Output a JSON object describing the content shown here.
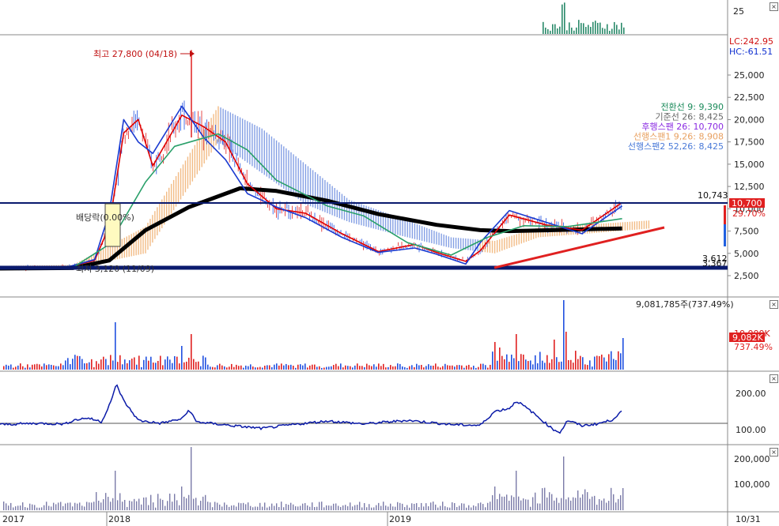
{
  "chart_data": [
    {
      "type": "line",
      "panel": "price",
      "title": "",
      "x_ticks": [
        "2017",
        "2018",
        "2019",
        "10/31"
      ],
      "y_ticks": [
        "25,000",
        "22,500",
        "20,000",
        "17,500",
        "15,000",
        "12,500",
        "10,000",
        "7,500",
        "5,000",
        "2,500"
      ],
      "ylim": [
        1000,
        28500
      ],
      "annotations": {
        "high": "최고 27,800 (04/18)",
        "low": "최저 3,120 (11/09)",
        "dividend": "배당락(0.00%)",
        "level_high": "10,743",
        "level_low_a": "3,612",
        "level_low_b": "3,367",
        "price_box": "10,700",
        "change_pct": "29.70%",
        "lc": "LC:242.95",
        "hc": "HC:-61.51"
      },
      "legend": [
        {
          "label": "전환선 9: 9,390",
          "color": "#1a8a5a"
        },
        {
          "label": "기준선 26: 8,425",
          "color": "#666666"
        },
        {
          "label": "후행스팬 26: 10,700",
          "color": "#8a2be2"
        },
        {
          "label": "선행스팬1 9,26: 8,908",
          "color": "#e8a060"
        },
        {
          "label": "선행스팬2 52,26: 8,425",
          "color": "#4a7ad8"
        }
      ],
      "series": [
        {
          "color": "#000000",
          "values": [
            [
              0,
              3300
            ],
            [
              0.1,
              3350
            ],
            [
              0.15,
              4200
            ],
            [
              0.2,
              7600
            ],
            [
              0.26,
              10200
            ],
            [
              0.33,
              12300
            ],
            [
              0.38,
              12000
            ],
            [
              0.45,
              10900
            ],
            [
              0.52,
              9400
            ],
            [
              0.6,
              8200
            ],
            [
              0.66,
              7600
            ],
            [
              0.7,
              7500
            ],
            [
              0.76,
              7600
            ],
            [
              0.855,
              7800
            ]
          ]
        },
        {
          "color": "#e00000",
          "values": [
            [
              0,
              3300
            ],
            [
              0.09,
              3400
            ],
            [
              0.13,
              4200
            ],
            [
              0.15,
              8000
            ],
            [
              0.17,
              18500
            ],
            [
              0.19,
              20000
            ],
            [
              0.21,
              14800
            ],
            [
              0.25,
              20500
            ],
            [
              0.28,
              19200
            ],
            [
              0.31,
              17500
            ],
            [
              0.34,
              12800
            ],
            [
              0.38,
              10000
            ],
            [
              0.42,
              9500
            ],
            [
              0.47,
              7200
            ],
            [
              0.52,
              5200
            ],
            [
              0.57,
              6000
            ],
            [
              0.6,
              5100
            ],
            [
              0.64,
              4100
            ],
            [
              0.66,
              5300
            ],
            [
              0.7,
              9300
            ],
            [
              0.75,
              8200
            ],
            [
              0.8,
              7600
            ],
            [
              0.855,
              10700
            ]
          ]
        },
        {
          "color": "#1a3ad0",
          "values": [
            [
              0,
              3300
            ],
            [
              0.09,
              3400
            ],
            [
              0.13,
              4300
            ],
            [
              0.15,
              9500
            ],
            [
              0.17,
              20000
            ],
            [
              0.19,
              17500
            ],
            [
              0.21,
              16200
            ],
            [
              0.25,
              21500
            ],
            [
              0.28,
              18000
            ],
            [
              0.31,
              15500
            ],
            [
              0.34,
              11700
            ],
            [
              0.38,
              10200
            ],
            [
              0.42,
              9000
            ],
            [
              0.47,
              6800
            ],
            [
              0.52,
              5100
            ],
            [
              0.57,
              5600
            ],
            [
              0.6,
              4900
            ],
            [
              0.64,
              3800
            ],
            [
              0.66,
              6200
            ],
            [
              0.7,
              9800
            ],
            [
              0.75,
              8500
            ],
            [
              0.8,
              7200
            ],
            [
              0.855,
              10300
            ]
          ]
        },
        {
          "color": "#2aa06a",
          "values": [
            [
              0.1,
              3400
            ],
            [
              0.15,
              6000
            ],
            [
              0.2,
              13000
            ],
            [
              0.24,
              17000
            ],
            [
              0.3,
              18400
            ],
            [
              0.34,
              16600
            ],
            [
              0.38,
              13200
            ],
            [
              0.45,
              10300
            ],
            [
              0.5,
              9200
            ],
            [
              0.56,
              6200
            ],
            [
              0.62,
              4800
            ],
            [
              0.67,
              6800
            ],
            [
              0.72,
              8100
            ],
            [
              0.78,
              8000
            ],
            [
              0.855,
              8900
            ]
          ]
        }
      ]
    },
    {
      "type": "bar",
      "panel": "volume",
      "label": "9,081,785주(737.49%)",
      "y_ticks": [
        "10,000K"
      ],
      "current_value": "9,082K",
      "current_pct": "737.49%"
    },
    {
      "type": "line",
      "panel": "oscillator",
      "y_ticks": [
        "200.00",
        "100.00"
      ],
      "ylim": [
        30,
        230
      ],
      "reference": 100,
      "series": [
        {
          "color": "#0a1aa8",
          "values": [
            [
              0,
              96
            ],
            [
              0.05,
              100
            ],
            [
              0.09,
              98
            ],
            [
              0.1,
              110
            ],
            [
              0.12,
              118
            ],
            [
              0.14,
              105
            ],
            [
              0.155,
              190
            ],
            [
              0.16,
              230
            ],
            [
              0.17,
              175
            ],
            [
              0.19,
              110
            ],
            [
              0.22,
              100
            ],
            [
              0.25,
              115
            ],
            [
              0.26,
              145
            ],
            [
              0.27,
              105
            ],
            [
              0.32,
              92
            ],
            [
              0.36,
              83
            ],
            [
              0.4,
              95
            ],
            [
              0.45,
              108
            ],
            [
              0.5,
              98
            ],
            [
              0.56,
              110
            ],
            [
              0.62,
              96
            ],
            [
              0.66,
              93
            ],
            [
              0.68,
              140
            ],
            [
              0.7,
              150
            ],
            [
              0.71,
              175
            ],
            [
              0.73,
              140
            ],
            [
              0.76,
              80
            ],
            [
              0.77,
              70
            ],
            [
              0.78,
              110
            ],
            [
              0.8,
              92
            ],
            [
              0.82,
              98
            ],
            [
              0.84,
              110
            ],
            [
              0.855,
              140
            ]
          ]
        }
      ]
    },
    {
      "type": "bar",
      "panel": "indicator",
      "y_ticks": [
        "200,000",
        "100,000"
      ],
      "ylim": [
        0,
        250000
      ]
    }
  ],
  "top_panel": {
    "y_tick": "25"
  }
}
